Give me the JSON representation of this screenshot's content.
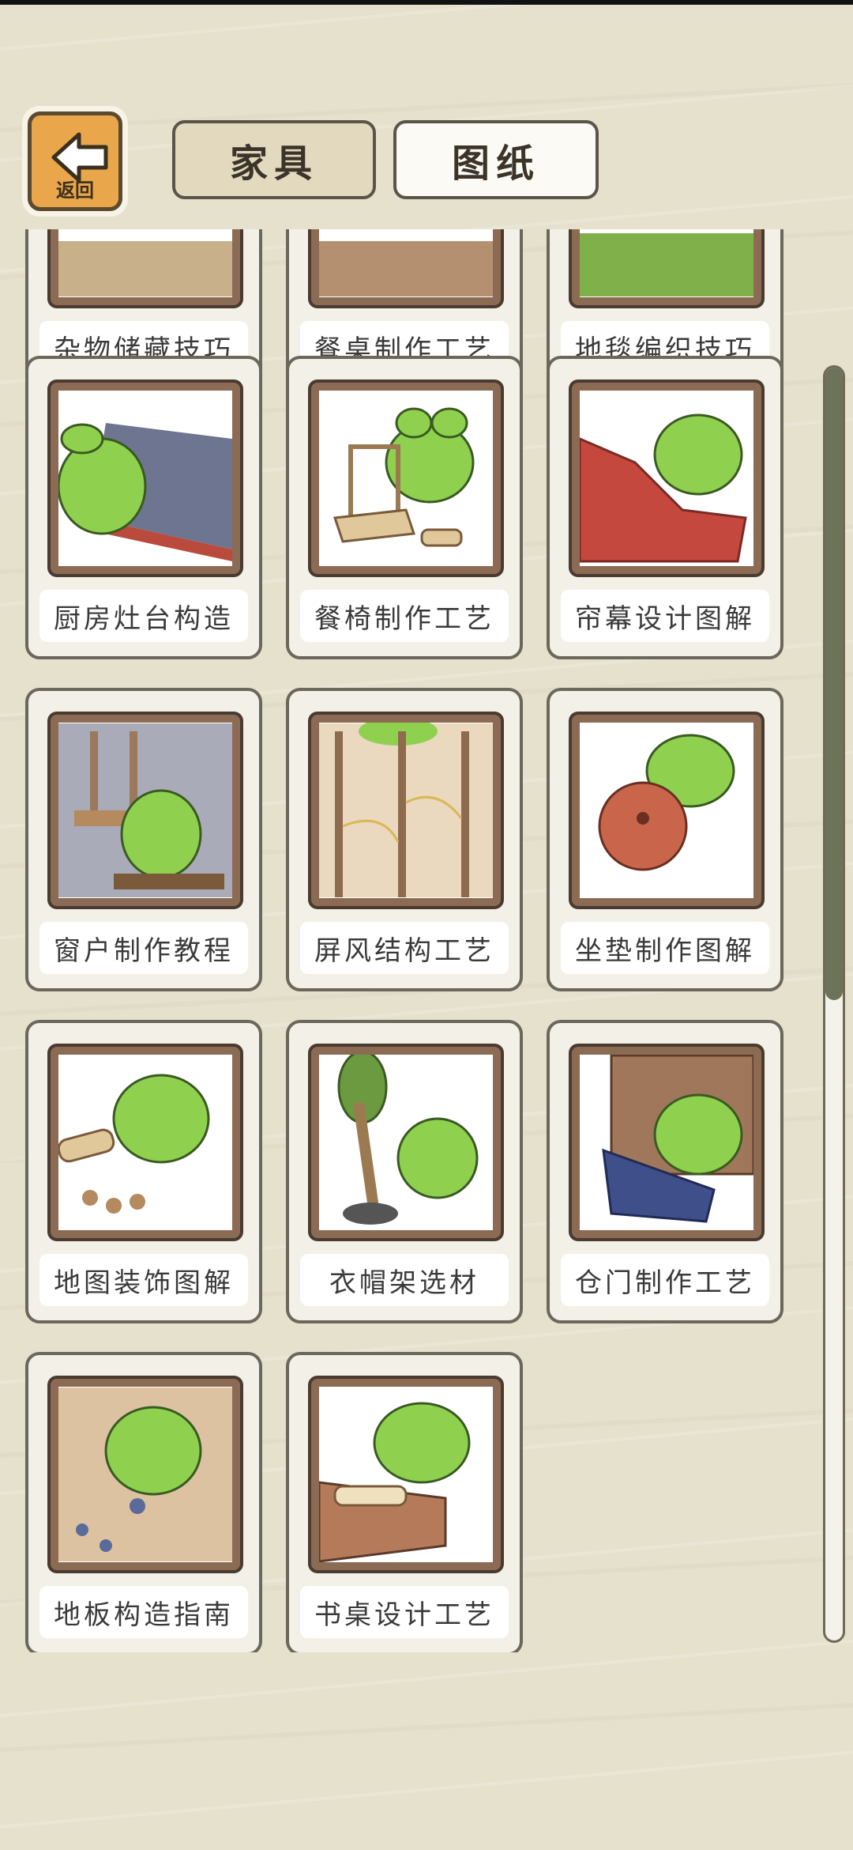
{
  "header": {
    "back_label": "返回",
    "tabs": [
      {
        "label": "家具",
        "selected": true
      },
      {
        "label": "图纸",
        "selected": false
      }
    ]
  },
  "blueprints": [
    {
      "label": "杂物储藏技巧"
    },
    {
      "label": "餐桌制作工艺"
    },
    {
      "label": "地毯编织技巧"
    },
    {
      "label": "厨房灶台构造"
    },
    {
      "label": "餐椅制作工艺"
    },
    {
      "label": "帘幕设计图解"
    },
    {
      "label": "窗户制作教程"
    },
    {
      "label": "屏风结构工艺"
    },
    {
      "label": "坐垫制作图解"
    },
    {
      "label": "地图装饰图解"
    },
    {
      "label": "衣帽架选材"
    },
    {
      "label": "仓门制作工艺"
    },
    {
      "label": "地板构造指南"
    },
    {
      "label": "书桌设计工艺"
    }
  ],
  "scroll": {
    "position_fraction": 0.55
  },
  "colors": {
    "background": "#e6e1cd",
    "frog_green": "#8fd14f",
    "button_orange": "#e9a64a",
    "frame_brown": "#8c6b55"
  },
  "icons": {
    "back": "left-arrow-icon"
  }
}
